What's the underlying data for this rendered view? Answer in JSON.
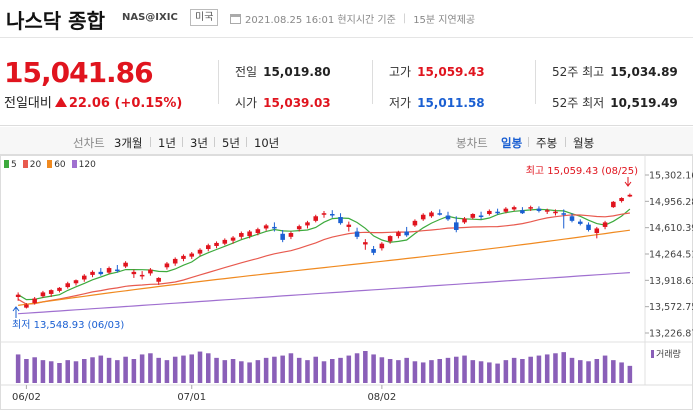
{
  "header": {
    "title": "나스닥 종합",
    "code": "NAS@IXIC",
    "market_badge": "미국",
    "datetime": "2021.08.25 16:01 현지시간 기준",
    "delay": "15분 지연제공"
  },
  "price": {
    "current": "15,041.86",
    "change_label": "전일대비",
    "change_value": "22.06 (+0.15%)"
  },
  "stats": {
    "prev_close_label": "전일",
    "prev_close": "15,019.80",
    "open_label": "시가",
    "open": "15,039.03",
    "high_label": "고가",
    "high": "15,059.43",
    "low_label": "저가",
    "low": "15,011.58",
    "w52_high_label": "52주 최고",
    "w52_high": "15,034.89",
    "w52_low_label": "52주 최저",
    "w52_low": "10,519.49"
  },
  "tabs": {
    "line_label": "선차트",
    "line_periods": [
      "3개월",
      "1년",
      "3년",
      "5년",
      "10년"
    ],
    "candle_label": "봉차트",
    "candle_periods": [
      "일봉",
      "주봉",
      "월봉"
    ],
    "active": "일봉"
  },
  "colors": {
    "up": "#e0141e",
    "down": "#1a5fd2",
    "ma5": "#3daa3d",
    "ma20": "#e85a4f",
    "ma60": "#f08a20",
    "ma120": "#a070d0",
    "volume": "#8a5fb8"
  },
  "chart_data": {
    "type": "candlestick",
    "moving_averages": [
      {
        "name": "5",
        "color": "#3daa3d"
      },
      {
        "name": "20",
        "color": "#e85a4f"
      },
      {
        "name": "60",
        "color": "#f08a20"
      },
      {
        "name": "120",
        "color": "#a070d0"
      }
    ],
    "y_ticks": [
      "15,302.16",
      "14,956.28",
      "14,610.39",
      "14,264.51",
      "13,918.63",
      "13,572.75",
      "13,226.87"
    ],
    "y_tick_values": [
      15302.16,
      14956.28,
      14610.39,
      14264.51,
      13918.63,
      13572.75,
      13226.87
    ],
    "ylim": [
      13226.87,
      15302.16
    ],
    "x_ticks": [
      "06/02",
      "07/01",
      "08/02"
    ],
    "high_annotation": "최고 15,059.43 (08/25)",
    "low_annotation": "최저 13,548.93 (06/03)",
    "volume_label": "거래량",
    "candles": [
      [
        13700,
        13760,
        13650,
        13730
      ],
      [
        13560,
        13620,
        13548.93,
        13600
      ],
      [
        13620,
        13700,
        13600,
        13680
      ],
      [
        13710,
        13780,
        13690,
        13760
      ],
      [
        13740,
        13800,
        13700,
        13790
      ],
      [
        13780,
        13830,
        13760,
        13820
      ],
      [
        13830,
        13900,
        13810,
        13880
      ],
      [
        13880,
        13930,
        13850,
        13920
      ],
      [
        13930,
        14000,
        13900,
        13980
      ],
      [
        13990,
        14050,
        13960,
        14030
      ],
      [
        14030,
        14080,
        13980,
        14000
      ],
      [
        14020,
        14100,
        14000,
        14080
      ],
      [
        14060,
        14120,
        14020,
        14040
      ],
      [
        14100,
        14170,
        14080,
        14150
      ],
      [
        14000,
        14060,
        13950,
        14030
      ],
      [
        13970,
        14040,
        13930,
        13990
      ],
      [
        14010,
        14080,
        13980,
        14060
      ],
      [
        13900,
        13960,
        13860,
        13950
      ],
      [
        14090,
        14160,
        14060,
        14140
      ],
      [
        14140,
        14220,
        14110,
        14200
      ],
      [
        14200,
        14260,
        14170,
        14240
      ],
      [
        14230,
        14290,
        14200,
        14270
      ],
      [
        14270,
        14340,
        14240,
        14320
      ],
      [
        14330,
        14400,
        14300,
        14380
      ],
      [
        14370,
        14430,
        14340,
        14410
      ],
      [
        14400,
        14470,
        14380,
        14450
      ],
      [
        14440,
        14500,
        14400,
        14480
      ],
      [
        14490,
        14560,
        14460,
        14540
      ],
      [
        14500,
        14580,
        14470,
        14560
      ],
      [
        14540,
        14610,
        14510,
        14590
      ],
      [
        14600,
        14660,
        14570,
        14640
      ],
      [
        14620,
        14680,
        14560,
        14600
      ],
      [
        14530,
        14580,
        14420,
        14450
      ],
      [
        14490,
        14560,
        14460,
        14540
      ],
      [
        14590,
        14650,
        14560,
        14630
      ],
      [
        14640,
        14700,
        14600,
        14680
      ],
      [
        14700,
        14780,
        14680,
        14760
      ],
      [
        14780,
        14830,
        14740,
        14800
      ],
      [
        14790,
        14840,
        14740,
        14780
      ],
      [
        14750,
        14800,
        14650,
        14670
      ],
      [
        14620,
        14690,
        14560,
        14650
      ],
      [
        14560,
        14610,
        14460,
        14490
      ],
      [
        14390,
        14460,
        14320,
        14420
      ],
      [
        14330,
        14370,
        14250,
        14280
      ],
      [
        14340,
        14420,
        14310,
        14400
      ],
      [
        14430,
        14510,
        14400,
        14500
      ],
      [
        14500,
        14570,
        14470,
        14550
      ],
      [
        14560,
        14620,
        14490,
        14510
      ],
      [
        14640,
        14720,
        14620,
        14700
      ],
      [
        14720,
        14800,
        14700,
        14780
      ],
      [
        14760,
        14830,
        14740,
        14810
      ],
      [
        14800,
        14850,
        14770,
        14790
      ],
      [
        14770,
        14820,
        14700,
        14720
      ],
      [
        14680,
        14760,
        14550,
        14580
      ],
      [
        14680,
        14750,
        14660,
        14730
      ],
      [
        14740,
        14800,
        14720,
        14790
      ],
      [
        14770,
        14820,
        14720,
        14760
      ],
      [
        14790,
        14850,
        14770,
        14830
      ],
      [
        14820,
        14860,
        14780,
        14800
      ],
      [
        14820,
        14880,
        14800,
        14860
      ],
      [
        14850,
        14900,
        14830,
        14880
      ],
      [
        14840,
        14880,
        14790,
        14800
      ],
      [
        14860,
        14900,
        14830,
        14880
      ],
      [
        14860,
        14890,
        14810,
        14830
      ],
      [
        14830,
        14860,
        14790,
        14840
      ],
      [
        14810,
        14850,
        14770,
        14820
      ],
      [
        14800,
        14850,
        14600,
        14780
      ],
      [
        14760,
        14800,
        14680,
        14700
      ],
      [
        14690,
        14720,
        14640,
        14660
      ],
      [
        14650,
        14680,
        14560,
        14580
      ],
      [
        14540,
        14620,
        14470,
        14600
      ],
      [
        14620,
        14700,
        14590,
        14680
      ],
      [
        14880,
        14960,
        14870,
        14950
      ],
      [
        14960,
        15010,
        14940,
        15000
      ],
      [
        15019.8,
        15059.43,
        15011.58,
        15041.86
      ]
    ],
    "volumes": [
      50,
      42,
      45,
      40,
      38,
      35,
      40,
      38,
      42,
      45,
      48,
      44,
      40,
      46,
      42,
      50,
      52,
      44,
      40,
      46,
      48,
      50,
      55,
      52,
      44,
      40,
      42,
      38,
      36,
      40,
      44,
      46,
      48,
      52,
      44,
      40,
      46,
      38,
      42,
      44,
      48,
      52,
      56,
      50,
      45,
      42,
      40,
      44,
      38,
      36,
      40,
      42,
      44,
      46,
      48,
      40,
      38,
      36,
      34,
      40,
      44,
      42,
      46,
      48,
      50,
      52,
      54,
      44,
      40,
      38,
      42,
      48,
      40,
      36,
      30
    ]
  }
}
